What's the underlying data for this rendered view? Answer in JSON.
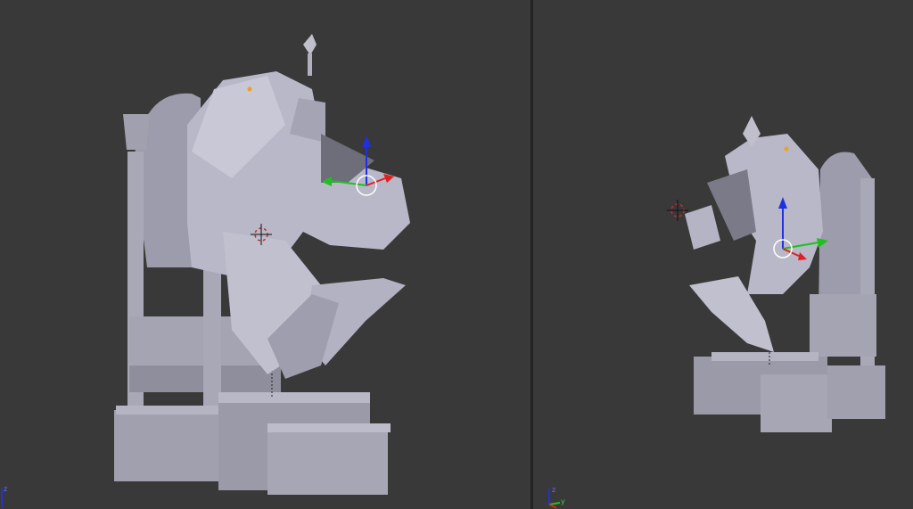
{
  "viewports": [
    {
      "name": "left",
      "axis_labels": {
        "z": "z",
        "y": "y"
      }
    },
    {
      "name": "right",
      "axis_labels": {
        "z": "z",
        "y": "y"
      }
    }
  ],
  "colors": {
    "background": "#393939",
    "model": "#b8b8c8",
    "model_shadow": "#8a8a98",
    "x_axis": "#e02020",
    "y_axis": "#20c020",
    "z_axis": "#2030e0"
  }
}
